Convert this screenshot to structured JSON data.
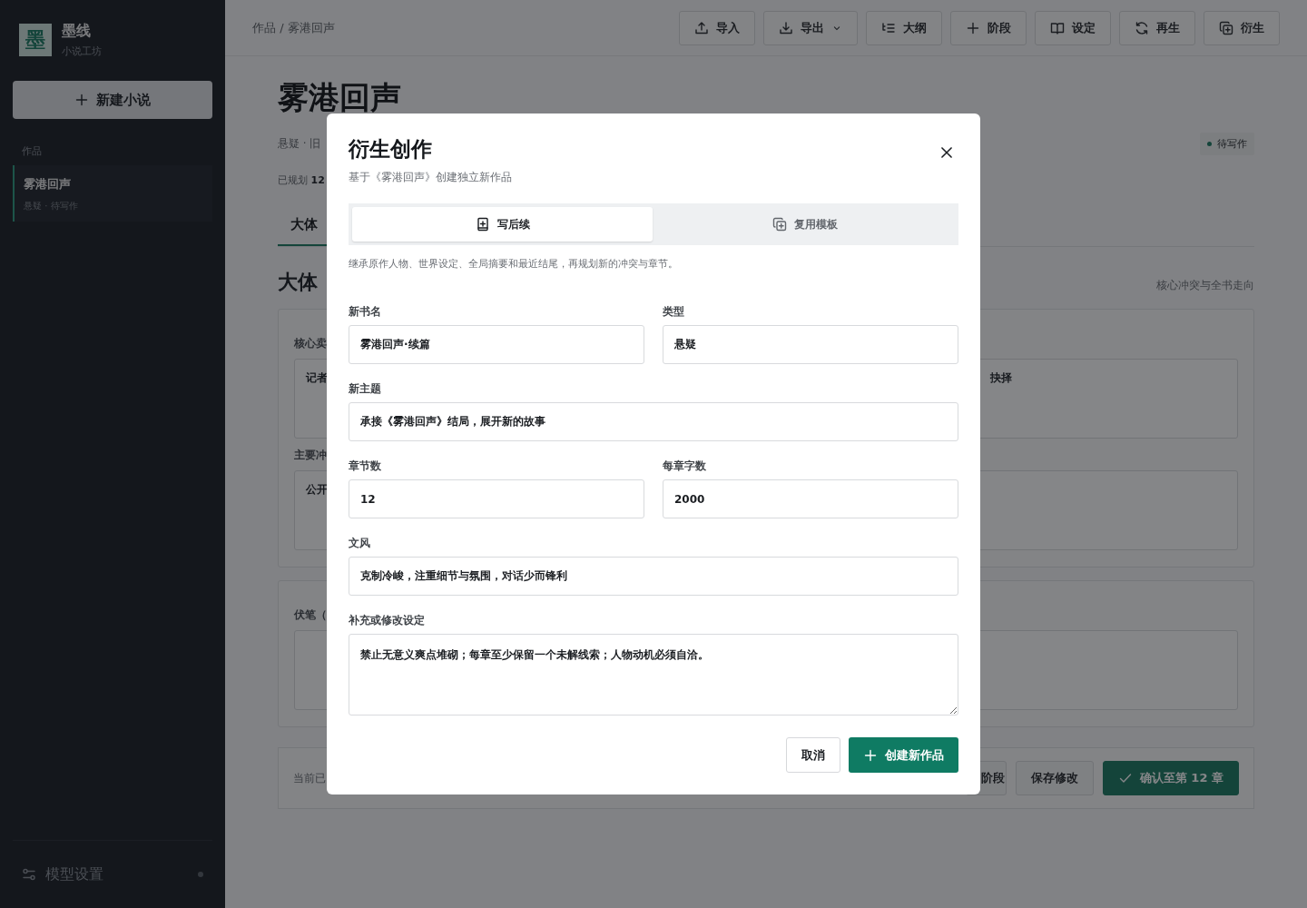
{
  "sidebar": {
    "logo": {
      "glyph": "墨",
      "title": "墨线",
      "subtitle": "小说工坊"
    },
    "new_button": "新建小说",
    "section": "作品",
    "items": [
      {
        "title": "雾港回声",
        "meta": "悬疑 · 待写作",
        "selected": true
      }
    ],
    "footer": {
      "label": "模型设置"
    }
  },
  "topbar": {
    "breadcrumb": "作品 / 雾港回声",
    "buttons": [
      {
        "label": "导入"
      },
      {
        "label": "导出",
        "dropdown": true
      },
      {
        "label": "大纲"
      },
      {
        "label": "阶段"
      },
      {
        "label": "设定"
      },
      {
        "label": "再生"
      },
      {
        "label": "衍生"
      }
    ]
  },
  "page": {
    "title": "雾港回声",
    "meta": "悬疑 · 旧",
    "status": "待写作",
    "progress_label": "已规划",
    "progress_value": "12",
    "tabs": [
      {
        "label": "大体",
        "selected": true
      }
    ],
    "section_title": "大体",
    "section_hint": "核心冲突与全书走向",
    "cards": [
      {
        "fields": [
          {
            "label": "核心卖",
            "text": "记者",
            "text_right": "抉择"
          },
          {
            "label": "主要冲",
            "text": "公开"
          }
        ]
      },
      {
        "fields": [
          {
            "label": "伏笔（"
          }
        ]
      }
    ],
    "footer": {
      "text": "当前已",
      "buttons": [
        {
          "label": "阶段",
          "kind": "secondary"
        },
        {
          "label": "保存修改",
          "kind": "secondary"
        },
        {
          "label": "确认至第 12 章",
          "kind": "primary"
        }
      ]
    }
  },
  "dialog": {
    "title": "衍生创作",
    "subtitle": "基于《雾港回声》创建独立新作品",
    "tabs": [
      {
        "label": "写后续",
        "selected": true
      },
      {
        "label": "复用模板",
        "selected": false
      }
    ],
    "hint": "继承原作人物、世界设定、全局摘要和最近结尾，再规划新的冲突与章节。",
    "rows": [
      [
        {
          "label": "新书名",
          "value": "雾港回声·续篇",
          "kind": "input"
        },
        {
          "label": "类型",
          "value": "悬疑",
          "kind": "input"
        }
      ],
      [
        {
          "label": "新主题",
          "value": "承接《雾港回声》结局，展开新的故事",
          "kind": "input"
        }
      ],
      [
        {
          "label": "章节数",
          "value": "12",
          "kind": "input"
        },
        {
          "label": "每章字数",
          "value": "2000",
          "kind": "input"
        }
      ],
      [
        {
          "label": "文风",
          "value": "克制冷峻，注重细节与氛围，对话少而锋利",
          "kind": "input"
        }
      ],
      [
        {
          "label": "补充或修改设定",
          "value": "禁止无意义爽点堆砌；每章至少保留一个未解线索；人物动机必须自洽。",
          "kind": "textarea"
        }
      ]
    ],
    "cancel": "取消",
    "confirm": "创建新作品"
  }
}
